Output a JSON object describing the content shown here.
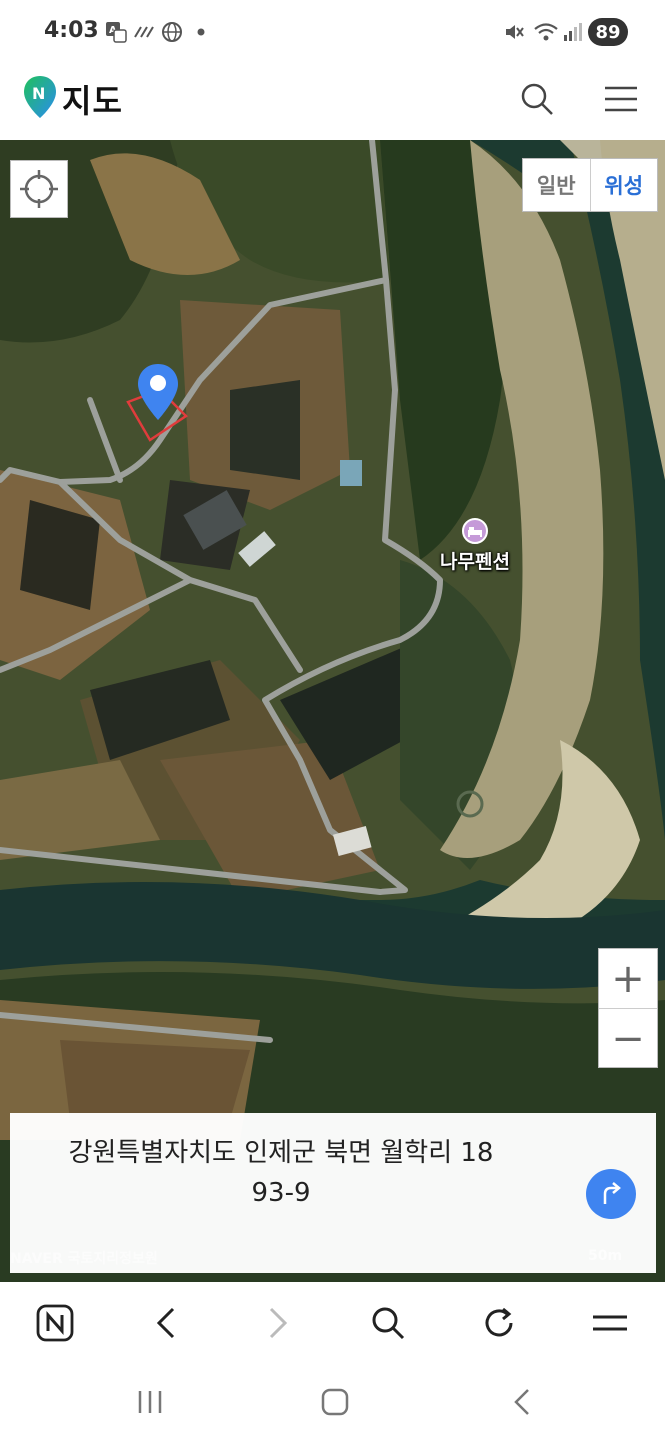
{
  "status_bar": {
    "time": "4:03",
    "battery": "89",
    "icons": [
      "translate-icon",
      "signal-slash-icon",
      "globe-icon",
      "dot-icon",
      "mute-icon",
      "wifi-icon",
      "cell-signal-icon"
    ]
  },
  "header": {
    "title": "지도",
    "logo_letter": "N",
    "icons": [
      "search-icon",
      "menu-icon"
    ]
  },
  "map": {
    "type_options": {
      "general": "일반",
      "satellite": "위성"
    },
    "selected_type": "satellite",
    "poi_label": "나무펜션",
    "zoom_in": "+",
    "zoom_out": "−",
    "attribution": "NAVER",
    "attribution_sub": "국토지리정보원",
    "scale": "50m",
    "colors": {
      "accent": "#2a6fd6",
      "pin": "#3f84f0",
      "poi": "#c59ad8"
    }
  },
  "address": {
    "line1": "강원특별자치도 인제군 북면 월학리 18",
    "line2": "93-9"
  },
  "browser_bar": {
    "icons": [
      "naver-home-icon",
      "back-icon",
      "forward-icon",
      "search-icon",
      "reload-icon",
      "tabs-menu-icon"
    ]
  },
  "system_nav": {
    "icons": [
      "recents-icon",
      "home-icon",
      "back-icon"
    ]
  }
}
